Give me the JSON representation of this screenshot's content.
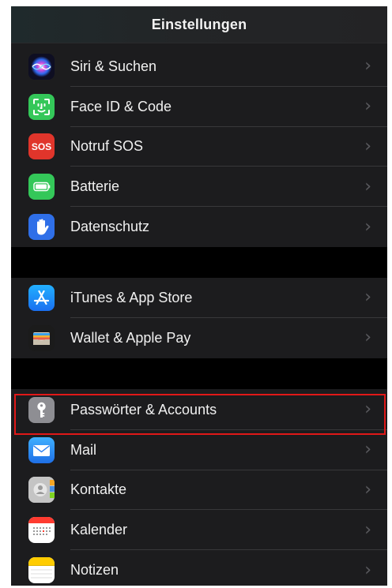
{
  "navbar": {
    "title": "Einstellungen"
  },
  "sections": [
    {
      "items": [
        {
          "id": "siri",
          "label": "Siri & Suchen",
          "icon": "siri-icon",
          "color": "#1d1d3a"
        },
        {
          "id": "faceid",
          "label": "Face ID & Code",
          "icon": "face-id-icon",
          "color": "#34c759"
        },
        {
          "id": "sos",
          "label": "Notruf SOS",
          "icon": "sos-icon",
          "icon_text": "SOS",
          "color": "#e0352b"
        },
        {
          "id": "battery",
          "label": "Batterie",
          "icon": "battery-icon",
          "color": "#34c759"
        },
        {
          "id": "privacy",
          "label": "Datenschutz",
          "icon": "hand-icon",
          "color": "#2f6fe8"
        }
      ]
    },
    {
      "items": [
        {
          "id": "appstore",
          "label": "iTunes & App Store",
          "icon": "app-store-icon",
          "color": "#1a8cf5"
        },
        {
          "id": "wallet",
          "label": "Wallet & Apple Pay",
          "icon": "wallet-icon",
          "color": "#1c1c1c"
        }
      ]
    },
    {
      "items": [
        {
          "id": "passwords",
          "label": "Passwörter & Accounts",
          "icon": "key-icon",
          "color": "#8e8e93",
          "highlighted": true
        },
        {
          "id": "mail",
          "label": "Mail",
          "icon": "mail-icon",
          "color": "#2a8cf0"
        },
        {
          "id": "contacts",
          "label": "Kontakte",
          "icon": "contacts-icon",
          "color": "#b9b9b9"
        },
        {
          "id": "calendar",
          "label": "Kalender",
          "icon": "calendar-icon",
          "color": "#ffffff"
        },
        {
          "id": "notes",
          "label": "Notizen",
          "icon": "notes-icon",
          "color": "#ffffff"
        }
      ]
    }
  ],
  "chevron": "›",
  "highlight_color": "#e01818"
}
